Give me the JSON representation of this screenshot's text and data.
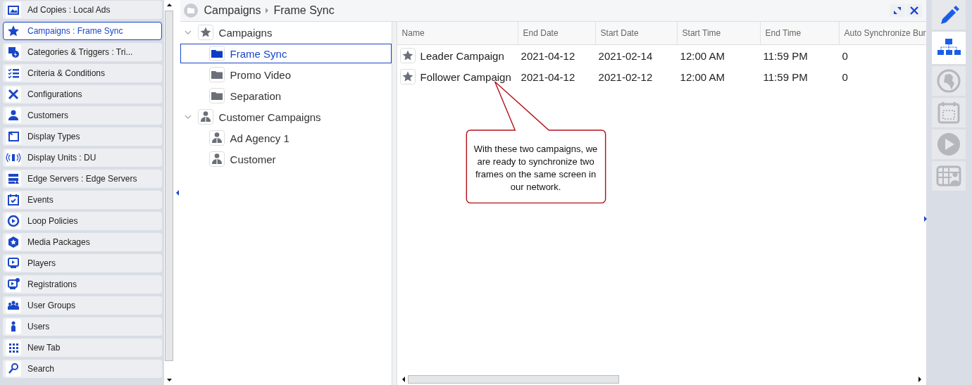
{
  "sidebar": {
    "items": [
      {
        "label": "Ad Copies : Local Ads",
        "selected": false
      },
      {
        "label": "Campaigns : Frame Sync",
        "selected": true
      },
      {
        "label": "Categories & Triggers : Tri...",
        "selected": false
      },
      {
        "label": "Criteria & Conditions",
        "selected": false
      },
      {
        "label": "Configurations",
        "selected": false
      },
      {
        "label": "Customers",
        "selected": false
      },
      {
        "label": "Display Types",
        "selected": false
      },
      {
        "label": "Display Units : DU",
        "selected": false
      },
      {
        "label": "Edge Servers : Edge Servers",
        "selected": false
      },
      {
        "label": "Events",
        "selected": false
      },
      {
        "label": "Loop Policies",
        "selected": false
      },
      {
        "label": "Media Packages",
        "selected": false
      },
      {
        "label": "Players",
        "selected": false
      },
      {
        "label": "Registrations",
        "selected": false
      },
      {
        "label": "User Groups",
        "selected": false
      },
      {
        "label": "Users",
        "selected": false
      },
      {
        "label": "New Tab",
        "selected": false
      },
      {
        "label": "Search",
        "selected": false
      }
    ]
  },
  "breadcrumb": [
    "Campaigns",
    "Frame Sync"
  ],
  "tree": [
    {
      "label": "Campaigns",
      "kind": "campaigns",
      "expanded": true,
      "selected": false,
      "children": [
        {
          "label": "Frame Sync",
          "kind": "folder",
          "selected": true
        },
        {
          "label": "Promo Video",
          "kind": "folder",
          "selected": false
        },
        {
          "label": "Separation",
          "kind": "folder",
          "selected": false
        }
      ]
    },
    {
      "label": "Customer Campaigns",
      "kind": "customers",
      "expanded": true,
      "selected": false,
      "children": [
        {
          "label": "Ad Agency 1",
          "kind": "customer",
          "selected": false
        },
        {
          "label": "Customer",
          "kind": "customer",
          "selected": false
        }
      ]
    }
  ],
  "table": {
    "columns": [
      "Name",
      "End Date",
      "Start Date",
      "Start Time",
      "End Time",
      "Auto Synchronize Bur"
    ],
    "rows": [
      {
        "cells": [
          "Leader Campaign",
          "2021-04-12",
          "2021-02-14",
          "12:00 AM",
          "11:59 PM",
          "0"
        ]
      },
      {
        "cells": [
          "Follower Campaign",
          "2021-04-12",
          "2021-02-12",
          "12:00 AM",
          "11:59 PM",
          "0"
        ]
      }
    ]
  },
  "callout": {
    "text": "With these two campaigns, we are ready to synchronize two frames on the same screen in our network."
  },
  "toolbar": [
    {
      "selected": false,
      "disabled": false
    },
    {
      "selected": true,
      "disabled": false
    },
    {
      "selected": false,
      "disabled": true
    },
    {
      "selected": false,
      "disabled": true
    },
    {
      "selected": false,
      "disabled": true
    },
    {
      "selected": false,
      "disabled": true
    }
  ]
}
